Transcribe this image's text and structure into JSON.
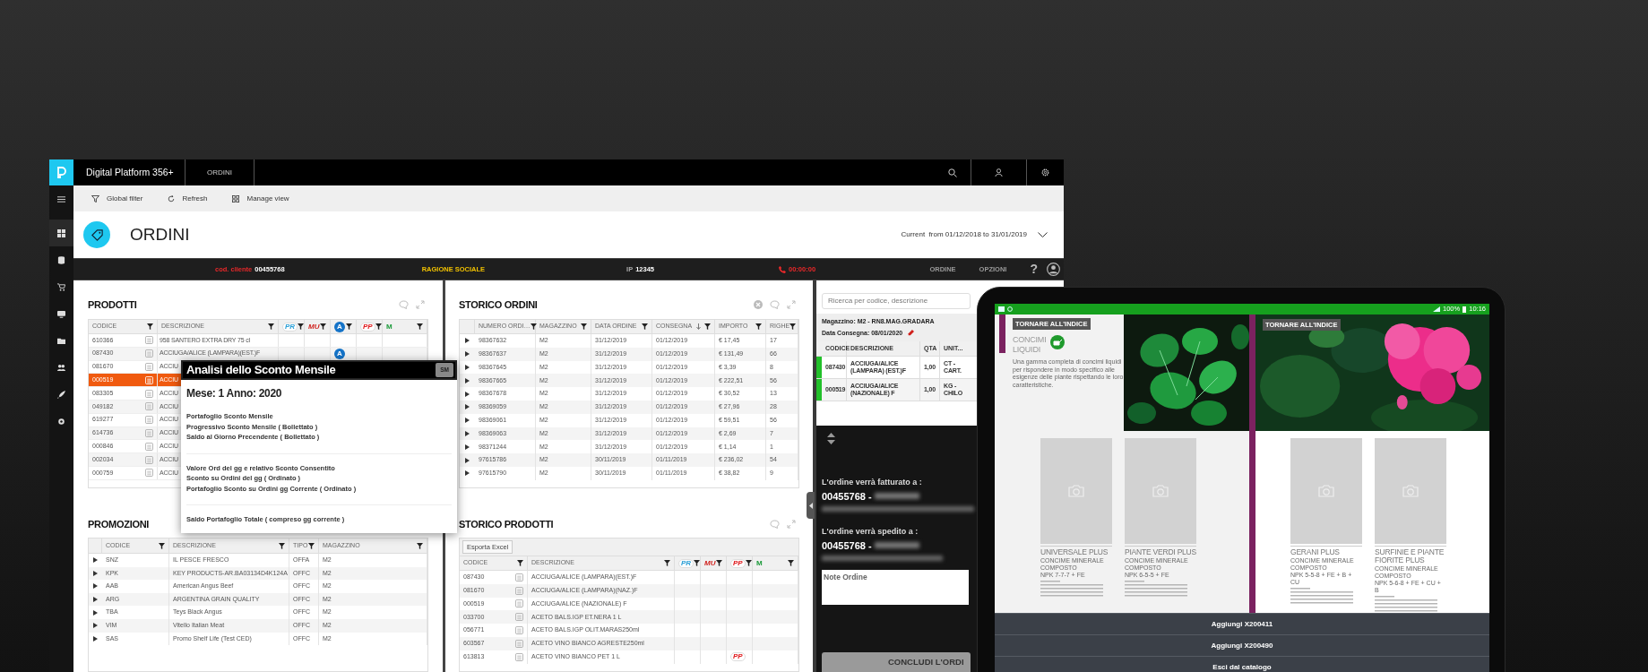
{
  "app": {
    "title": "Digital Platform 356+",
    "tab": "ORDINI"
  },
  "toolbar": [
    {
      "label": "Global filter",
      "kind": "filter"
    },
    {
      "label": "Refresh",
      "kind": "refresh"
    },
    {
      "label": "Manage view",
      "kind": "grid"
    }
  ],
  "page": {
    "title": "ORDINI",
    "period": "Current  from 01/12/2018 to 31/01/2019"
  },
  "info_bar": {
    "client_label": "cod. cliente",
    "client_code": "00455768",
    "company": "RAGIONE SOCIALE",
    "ip_label": "IP",
    "ip": "12345",
    "timer": "00:00:00",
    "menu": [
      "ORDINE",
      "OPZIONI"
    ],
    "help": "?"
  },
  "prodotti": {
    "title": "PRODOTTI",
    "columns": [
      "CODICE",
      "DESCRIZIONE"
    ],
    "badge_columns": [
      {
        "label": "PR",
        "kind": "pr"
      },
      {
        "label": "MU",
        "kind": "mu"
      },
      {
        "label": "A",
        "kind": "a"
      },
      {
        "label": "PP",
        "kind": "pp"
      },
      {
        "label": "M",
        "kind": "m"
      }
    ],
    "rows": [
      {
        "code": "610366",
        "description": "958 SANTERO EXTRA DRY 75 cl",
        "selected": false
      },
      {
        "code": "087430",
        "description": "ACCIUGA/ALICE (LAMPARA)(EST.)F",
        "selected": false,
        "flags": [
          false,
          false,
          true,
          false,
          false
        ],
        "flag_label": "A"
      },
      {
        "code": "081670",
        "description": "ACCIU",
        "selected": false
      },
      {
        "code": "000519",
        "description": "ACCIU",
        "selected": true
      },
      {
        "code": "083305",
        "description": "ACCIU",
        "selected": false
      },
      {
        "code": "049182",
        "description": "ACCIU",
        "selected": false
      },
      {
        "code": "619277",
        "description": "ACCIU",
        "selected": false
      },
      {
        "code": "614736",
        "description": "ACCIU",
        "selected": false
      },
      {
        "code": "000846",
        "description": "ACCIU",
        "selected": false
      },
      {
        "code": "002034",
        "description": "ACCIU",
        "selected": false
      },
      {
        "code": "000759",
        "description": "ACCIU",
        "selected": false
      }
    ]
  },
  "popup": {
    "title": "Analisi dello Sconto Mensile",
    "badge": "SM",
    "subtitle": "Mese: 1 Anno: 2020",
    "groups": [
      [
        "Portafoglio Sconto Mensile",
        "Progressivo Sconto Mensile ( Bollettato )",
        "Saldo al Giorno Precendente ( Bollettato )"
      ],
      [
        "Valore Ord del gg e relativo Sconto Consentito",
        "Sconto su Ordini del gg ( Ordinato )",
        "Portafoglio Sconto su Ordini gg Corrente ( Ordinato )"
      ],
      [
        "Saldo Portafoglio Totale ( compreso gg corrente )"
      ]
    ]
  },
  "promozioni": {
    "title": "PROMOZIONI",
    "columns": [
      "CODICE",
      "DESCRIZIONE",
      "TIPO",
      "MAGAZZINO"
    ],
    "rows": [
      [
        "SNZ",
        "IL PESCE FRESCO",
        "OFFA",
        "M2"
      ],
      [
        "KPK",
        "KEY PRODUCTS-AR.BA03134D4K124A",
        "OFFC",
        "M2"
      ],
      [
        "AAB",
        "American Angus Beef",
        "OFFC",
        "M2"
      ],
      [
        "ARG",
        "ARGENTINA GRAIN QUALITY",
        "OFFC",
        "M2"
      ],
      [
        "TBA",
        "Teys Black Angus",
        "OFFC",
        "M2"
      ],
      [
        "VIM",
        "Vitello Italian Meat",
        "OFFC",
        "M2"
      ],
      [
        "SAS",
        "Promo Shelf Life (Test CED)",
        "OFFC",
        "M2"
      ]
    ]
  },
  "storico_ordini": {
    "title": "STORICO ORDINI",
    "columns": [
      "NUMERO ORDI…",
      "MAGAZZINO",
      "DATA ORDINE",
      "CONSEGNA",
      "IMPORTO",
      "RIGHE"
    ],
    "rows": [
      [
        "98367632",
        "M2",
        "31/12/2019",
        "01/12/2019",
        "€ 17,45",
        "17"
      ],
      [
        "98367637",
        "M2",
        "31/12/2019",
        "01/12/2019",
        "€ 131,49",
        "66"
      ],
      [
        "98367645",
        "M2",
        "31/12/2019",
        "01/12/2019",
        "€ 3,39",
        "8"
      ],
      [
        "98367665",
        "M2",
        "31/12/2019",
        "01/12/2019",
        "€ 222,51",
        "56"
      ],
      [
        "98367678",
        "M2",
        "31/12/2019",
        "01/12/2019",
        "€ 30,52",
        "13"
      ],
      [
        "98369059",
        "M2",
        "31/12/2019",
        "01/12/2019",
        "€ 27,96",
        "28"
      ],
      [
        "98369061",
        "M2",
        "31/12/2019",
        "01/12/2019",
        "€ 59,51",
        "56"
      ],
      [
        "98369063",
        "M2",
        "31/12/2019",
        "01/12/2019",
        "€ 2,69",
        "7"
      ],
      [
        "98371244",
        "M2",
        "31/12/2019",
        "01/12/2019",
        "€ 1,14",
        "1"
      ],
      [
        "97615786",
        "M2",
        "30/11/2019",
        "01/11/2019",
        "€ 236,02",
        "54"
      ],
      [
        "97615790",
        "M2",
        "30/11/2019",
        "01/11/2019",
        "€ 38,82",
        "9"
      ]
    ]
  },
  "storico_prodotti": {
    "title": "STORICO PRODOTTI",
    "export": "Esporta Excel",
    "columns": [
      "CODICE",
      "DESCRIZIONE"
    ],
    "badge_columns": [
      {
        "label": "PR",
        "kind": "pr"
      },
      {
        "label": "MU",
        "kind": "mu"
      },
      {
        "label": "PP",
        "kind": "pp"
      },
      {
        "label": "M",
        "kind": "m"
      }
    ],
    "rows": [
      {
        "code": "087430",
        "description": "ACCIUGA/ALICE (LAMPARA)(EST.)F"
      },
      {
        "code": "081670",
        "description": "ACCIUGA/ALICE (LAMPARA)(NAZ.)F"
      },
      {
        "code": "000519",
        "description": "ACCIUGA/ALICE (NAZIONALE) F"
      },
      {
        "code": "033700",
        "description": "ACETO BALS.IGP ET.NERA 1 L"
      },
      {
        "code": "056771",
        "description": "ACETO BALS.IGP OLIT.MARAS250ml"
      },
      {
        "code": "603567",
        "description": "ACETO VINO BIANCO AGRESTE250ml"
      },
      {
        "code": "613813",
        "description": "ACETO VINO BIANCO PET 1 L",
        "flags": [
          false,
          false,
          true,
          false
        ],
        "flag_label": "PP"
      }
    ]
  },
  "order": {
    "search_placeholder": "Ricerca per codice, descrizione",
    "warehouse": "Magazzino: M2 - RN8.MAG.GRADARA",
    "delivery": "Data Consegna: 08/01/2020",
    "columns": [
      "CODICE",
      "DESCRIZIONE",
      "QTA",
      "UNIT..."
    ],
    "rows": [
      [
        "087430",
        "ACCIUGA/ALICE (LAMPARA) (EST.)F",
        "1,00",
        "CT - CART."
      ],
      [
        "000519",
        "ACCIUGA/ALICE (NAZIONALE) F",
        "1,00",
        "KG - CHILO"
      ]
    ],
    "billing_label": "L'ordine verrà fatturato a :",
    "billing_code": "00455768 -",
    "shipping_label": "L'ordine verrà spedito a :",
    "shipping_code": "00455768 -",
    "notes_placeholder": "Note Ordine",
    "submit": "CONCLUDI L'ORDI"
  },
  "tablet": {
    "battery": "100%",
    "time": "10:16",
    "back": [
      "TORNARE ALL'INDICE",
      "TORNARE ALL'INDICE"
    ],
    "category": "CONCIMI LIQUIDI",
    "intro": "Una gamma completa di concimi liquidi per rispondere in modo specifico alle esigenze delle piante rispettando le loro caratteristiche.",
    "products": [
      {
        "name": "UNIVERSALE PLUS",
        "subtitle": "CONCIME MINERALE COMPOSTO",
        "npk": "NPK 7-7-7 + FE"
      },
      {
        "name": "PIANTE VERDI PLUS",
        "subtitle": "CONCIME MINERALE COMPOSTO",
        "npk": "NPK 6-5-5 + FE"
      },
      {
        "name": "GERANI PLUS",
        "subtitle": "CONCIME MINERALE COMPOSTO",
        "npk": "NPK 5-5-8 + FE + B + CU"
      },
      {
        "name": "SURFINIE E PIANTE FIORITE PLUS",
        "subtitle": "CONCIME MINERALE COMPOSTO",
        "npk": "NPK 5-6-8 + FE + CU + B"
      }
    ],
    "actions": [
      "Aggiungi X200411",
      "Aggiungi X200490",
      "Esci dal catalogo"
    ]
  }
}
